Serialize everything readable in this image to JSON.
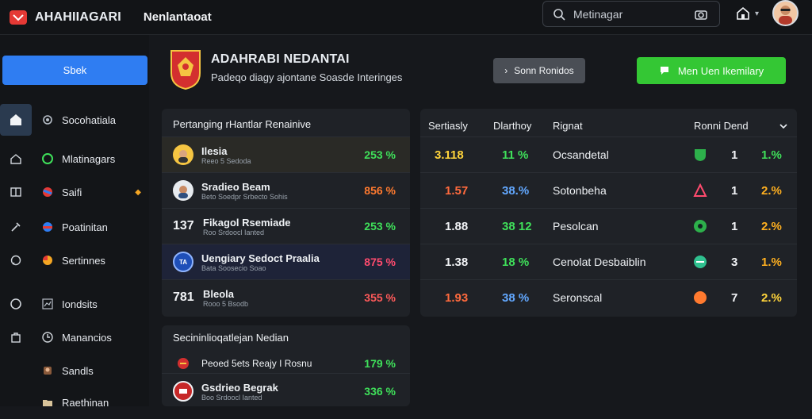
{
  "topbar": {
    "brand_name": "AHAHIIAGARI",
    "brand_sub": "Nenlantaoat",
    "search_placeholder": "Metinagar",
    "colors": {
      "accent_blue": "#2f7df2",
      "accent_green": "#34c734",
      "accent_red": "#e53935"
    }
  },
  "sidebar": {
    "primary_button": "Sbek",
    "items": [
      {
        "icon": "home-icon",
        "label": "Socohatiala",
        "active": true
      },
      {
        "icon": "green-circle-icon",
        "label": "Mlatinagars",
        "active": false
      },
      {
        "icon": "flag-icon",
        "label": "Saifi",
        "active": false,
        "star": "◆"
      },
      {
        "icon": "globe-icon",
        "label": "Poatinitan",
        "active": false
      },
      {
        "icon": "ball-icon",
        "label": "Sertinnes",
        "active": false
      },
      {
        "icon": "chart-icon",
        "label": "Iondsits",
        "active": false
      },
      {
        "icon": "clock-icon",
        "label": "Manancios",
        "active": false
      },
      {
        "icon": "user-icon",
        "label": "Sandls",
        "active": false
      },
      {
        "icon": "folder-icon",
        "label": "Raethinan",
        "active": false
      }
    ]
  },
  "header": {
    "title": "ADAHRABI NEDANTAI",
    "subtitle": "Padeqo diagy ajontane Soasde Interinges",
    "btn_gray": "Sonn Ronidos",
    "btn_green": "Men Uen Ikemilary"
  },
  "left_table": {
    "title": "Pertanging rHantlar Renainive",
    "rows": [
      {
        "lead": "avatar",
        "name": "Ilesia",
        "sub": "Reeo 5 Sedoda",
        "pct": "253 %",
        "color": "#3fe05a"
      },
      {
        "lead": "avatar",
        "name": "Sradieo Beam",
        "sub": "Beto Soedpr Srbecto Sohis",
        "pct": "856 %",
        "color": "#ff7a2f"
      },
      {
        "lead": "num",
        "num": "137",
        "name": "Fikagol Rsemiade",
        "sub": "Roo Srdoocl Ianted",
        "pct": "253 %",
        "color": "#3fe05a"
      },
      {
        "lead": "badge",
        "name": "Uengiary Sedoct Praalia",
        "sub": "Bata Soosecio Soao",
        "pct": "875 %",
        "color": "#ff4b6e"
      },
      {
        "lead": "num",
        "num": "781",
        "name": "Bleola",
        "sub": "Rooo 5 Bsodb",
        "pct": "355 %",
        "color": "#ff5a5a"
      }
    ]
  },
  "bottom_table": {
    "title": "Secininlioqatlejan Nedian",
    "rows": [
      {
        "name": "Peoed 5ets Reajy I Rosnu",
        "pct": "179 %",
        "color": "#3fe05a"
      },
      {
        "name": "Gsdrieo Begrak",
        "sub": "Boo Srdoocl Ianted",
        "pct": "336 %",
        "color": "#3fe05a"
      }
    ]
  },
  "right_table": {
    "headers": [
      "Sertiasly",
      "Dlarthoy",
      "Rignat",
      "Ronni Dend"
    ],
    "rows": [
      {
        "a": "3.118",
        "a_color": "#ffd43b",
        "b": "11 %",
        "b_color": "#3fe05a",
        "name": "Ocsandetal",
        "icon_color": "#2db04b",
        "rank": "1",
        "pct": "1.%",
        "pct_color": "#3fe05a"
      },
      {
        "a": "1.57",
        "a_color": "#ff6a3d",
        "b": "38.%",
        "b_color": "#62a8ff",
        "name": "Sotonbeha",
        "icon_color": "#ff4b6e",
        "rank": "1",
        "pct": "2.%",
        "pct_color": "#ffb020"
      },
      {
        "a": "1.88",
        "a_color": "#f1f3f6",
        "b": "38 12",
        "b_color": "#3fe05a",
        "name": "Pesolcan",
        "icon_color": "#2db04b",
        "rank": "1",
        "pct": "2.%",
        "pct_color": "#ffb020"
      },
      {
        "a": "1.38",
        "a_color": "#f1f3f6",
        "b": "18 %",
        "b_color": "#3fe05a",
        "name": "Cenolat Desbaiblin",
        "icon_color": "#2fc08f",
        "rank": "3",
        "pct": "1.%",
        "pct_color": "#ffb020"
      },
      {
        "a": "1.93",
        "a_color": "#ff6a3d",
        "b": "38 %",
        "b_color": "#62a8ff",
        "name": "Seronscal",
        "icon_color": "#ff7a2f",
        "rank": "7",
        "pct": "2.%",
        "pct_color": "#ffd43b"
      }
    ]
  }
}
